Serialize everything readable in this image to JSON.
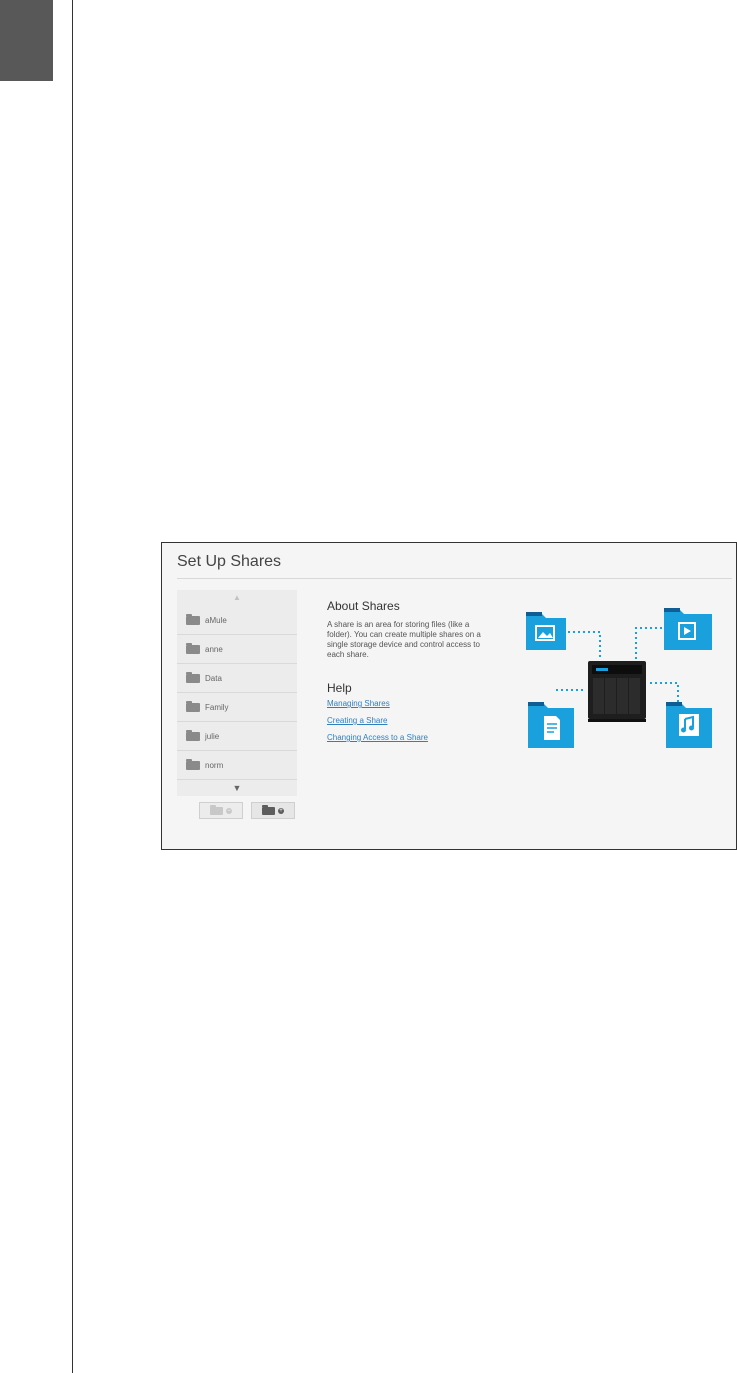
{
  "dialog": {
    "title": "Set Up Shares"
  },
  "shares": {
    "scroll_up_icon": "triangle-up",
    "scroll_down_icon": "triangle-down",
    "items": [
      {
        "label": "aMule",
        "icon": "folder"
      },
      {
        "label": "anne",
        "icon": "folder"
      },
      {
        "label": "Data",
        "icon": "folder"
      },
      {
        "label": "Family",
        "icon": "folder"
      },
      {
        "label": "julie",
        "icon": "folder"
      },
      {
        "label": "norm",
        "icon": "folder"
      }
    ],
    "remove_button_icon": "folder-remove",
    "add_button_icon": "folder-add"
  },
  "about": {
    "heading": "About Shares",
    "body": "A share is an area for storing files (like a folder). You can create multiple shares on a single storage device and control access to each share."
  },
  "help": {
    "heading": "Help",
    "links": [
      "Managing Shares",
      "Creating a Share",
      "Changing Access to a Share"
    ]
  },
  "colors": {
    "accent": "#1aa0dc",
    "folder_dark": "#0f5d92",
    "link": "#2f7fc0",
    "tab_block": "#585858"
  }
}
